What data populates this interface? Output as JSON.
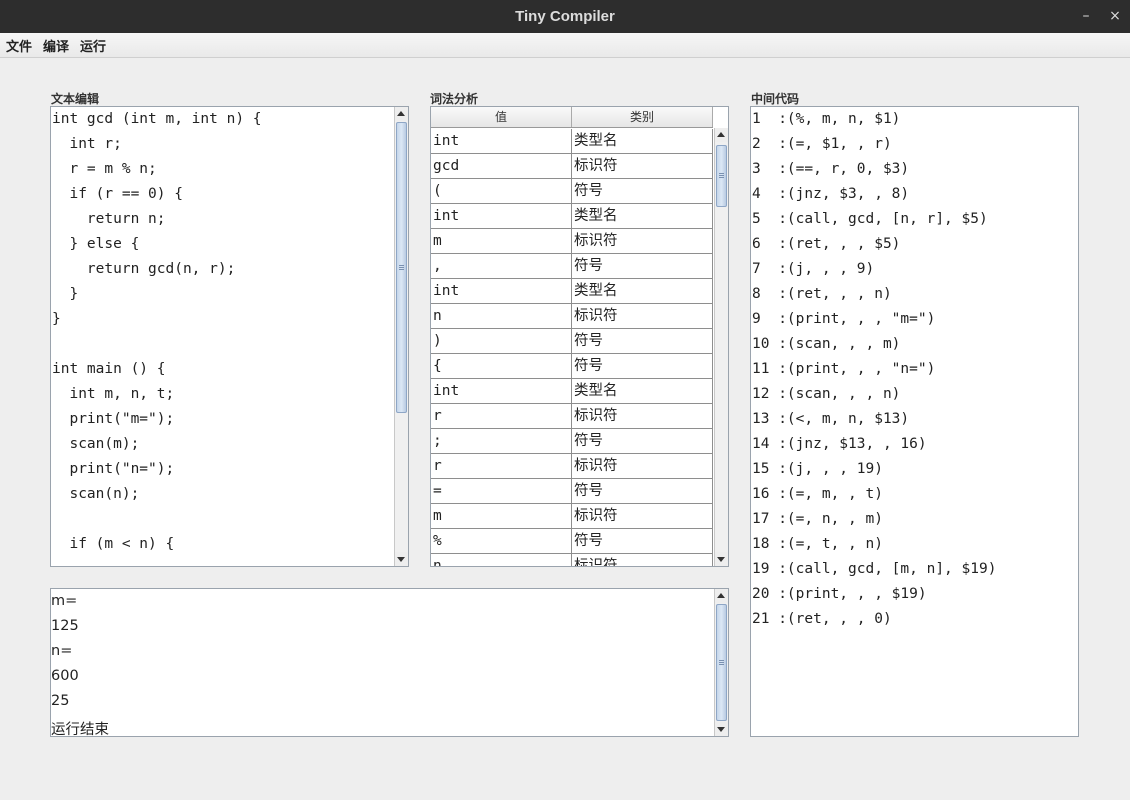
{
  "window": {
    "title": "Tiny Compiler",
    "minimize_glyph": "–",
    "close_glyph": "×"
  },
  "menu": [
    "文件",
    "编译",
    "运行"
  ],
  "labels": {
    "editor": "文本编辑",
    "lexer": "词法分析",
    "ir": "中间代码"
  },
  "editor": {
    "lines": [
      "int gcd (int m, int n) {",
      "  int r;",
      "  r = m % n;",
      "  if (r == 0) {",
      "    return n;",
      "  } else {",
      "    return gcd(n, r);",
      "  }",
      "}",
      "",
      "int main () {",
      "  int m, n, t;",
      "  print(\"m=\");",
      "  scan(m);",
      "  print(\"n=\");",
      "  scan(n);",
      "",
      "  if (m < n) {"
    ]
  },
  "lexer": {
    "headers": [
      "值",
      "类别"
    ],
    "rows": [
      [
        "int",
        "类型名"
      ],
      [
        "gcd",
        "标识符"
      ],
      [
        "(",
        "符号"
      ],
      [
        "int",
        "类型名"
      ],
      [
        "m",
        "标识符"
      ],
      [
        ",",
        "符号"
      ],
      [
        "int",
        "类型名"
      ],
      [
        "n",
        "标识符"
      ],
      [
        ")",
        "符号"
      ],
      [
        "{",
        "符号"
      ],
      [
        "int",
        "类型名"
      ],
      [
        "r",
        "标识符"
      ],
      [
        ";",
        "符号"
      ],
      [
        "r",
        "标识符"
      ],
      [
        "=",
        "符号"
      ],
      [
        "m",
        "标识符"
      ],
      [
        "%",
        "符号"
      ],
      [
        "n",
        "标识符"
      ]
    ]
  },
  "ir": {
    "lines": [
      "1  :(%, m, n, $1)",
      "2  :(=, $1, , r)",
      "3  :(==, r, 0, $3)",
      "4  :(jnz, $3, , 8)",
      "5  :(call, gcd, [n, r], $5)",
      "6  :(ret, , , $5)",
      "7  :(j, , , 9)",
      "8  :(ret, , , n)",
      "9  :(print, , , \"m=\")",
      "10 :(scan, , , m)",
      "11 :(print, , , \"n=\")",
      "12 :(scan, , , n)",
      "13 :(<, m, n, $13)",
      "14 :(jnz, $13, , 16)",
      "15 :(j, , , 19)",
      "16 :(=, m, , t)",
      "17 :(=, n, , m)",
      "18 :(=, t, , n)",
      "19 :(call, gcd, [m, n], $19)",
      "20 :(print, , , $19)",
      "21 :(ret, , , 0)"
    ]
  },
  "output": {
    "lines": [
      "m=",
      "125",
      "n=",
      "600",
      "25",
      "运行结束"
    ]
  },
  "colors": {
    "titlebar": "#2d2d2d",
    "background": "#eeeeee",
    "scroll_thumb": "#c6d6ea"
  }
}
